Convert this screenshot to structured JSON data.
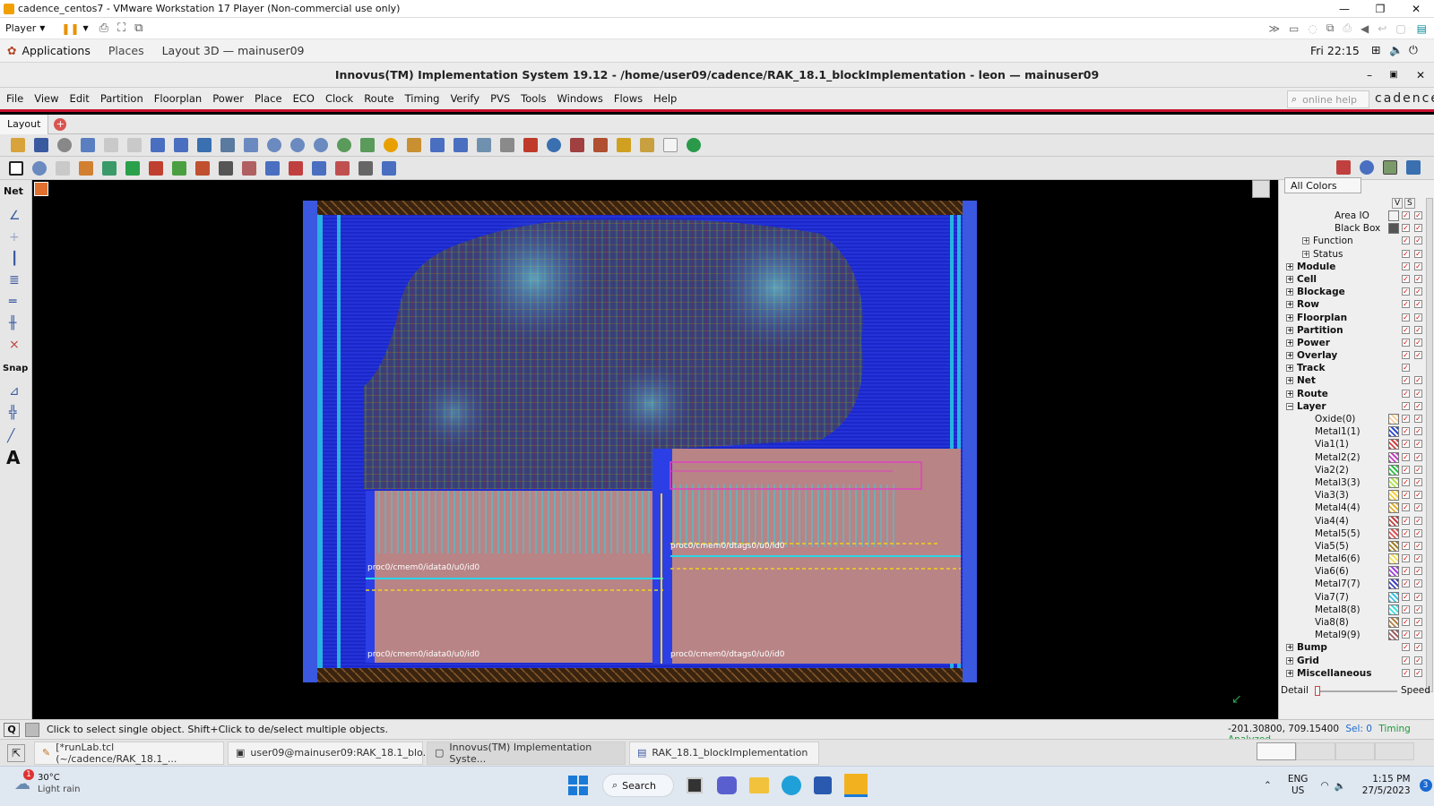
{
  "vm": {
    "title": "cadence_centos7 - VMware Workstation 17 Player (Non-commercial use only)",
    "player_label": "Player"
  },
  "gnome": {
    "applications": "Applications",
    "places": "Places",
    "window": "Layout 3D — mainuser09",
    "clock": "Fri 22:15"
  },
  "app": {
    "title": "Innovus(TM) Implementation System 19.12 - /home/user09/cadence/RAK_18.1_blockImplementation - leon — mainuser09",
    "menu": [
      "File",
      "View",
      "Edit",
      "Partition",
      "Floorplan",
      "Power",
      "Place",
      "ECO",
      "Clock",
      "Route",
      "Timing",
      "Verify",
      "PVS",
      "Tools",
      "Windows",
      "Flows",
      "Help"
    ],
    "search_placeholder": "online help",
    "brand": "cadence",
    "tab": "Layout"
  },
  "left_toolbar": {
    "net_label": "Net",
    "snap_label": "Snap",
    "text_label": "A"
  },
  "canvas": {
    "labels": [
      "proc0/cmem0/idata0/u0/id0",
      "proc0/cmem0/dtags0/u0/id0",
      "proc0/cmem0/idata0/u0/id0",
      "proc0/cmem0/dtags0/u0/id0"
    ]
  },
  "right_panel": {
    "all_colors": "All Colors",
    "col_v": "V",
    "col_s": "S",
    "sub_items": [
      "Area IO",
      "Black Box",
      "Function",
      "Status"
    ],
    "categories": [
      "Module",
      "Cell",
      "Blockage",
      "Row",
      "Floorplan",
      "Partition",
      "Power",
      "Overlay",
      "Track",
      "Net",
      "Route",
      "Layer"
    ],
    "layers": [
      "Oxide(0)",
      "Metal1(1)",
      "Via1(1)",
      "Metal2(2)",
      "Via2(2)",
      "Metal3(3)",
      "Via3(3)",
      "Metal4(4)",
      "Via4(4)",
      "Metal5(5)",
      "Via5(5)",
      "Metal6(6)",
      "Via6(6)",
      "Metal7(7)",
      "Via7(7)",
      "Metal8(8)",
      "Via8(8)",
      "Metal9(9)"
    ],
    "bottom_categories": [
      "Bump",
      "Grid",
      "Miscellaneous"
    ],
    "detail": "Detail",
    "speed": "Speed"
  },
  "status": {
    "message": "Click to select single object. Shift+Click to de/select multiple objects.",
    "coords": "-201.30800, 709.15400",
    "sel": "Sel: 0",
    "timing": "Timing Analyzed",
    "q": "Q"
  },
  "taskbar": {
    "items": [
      "[*runLab.tcl (~/cadence/RAK_18.1_...",
      "user09@mainuser09:RAK_18.1_blo...",
      "Innovus(TM) Implementation Syste...",
      "RAK_18.1_blockImplementation"
    ]
  },
  "windows": {
    "weather_temp": "30°C",
    "weather_desc": "Light rain",
    "search": "Search",
    "lang1": "ENG",
    "lang2": "US",
    "time": "1:15 PM",
    "date": "27/5/2023",
    "notif_count": "1",
    "badge_count": "3"
  },
  "colors": {
    "accent_red": "#c8102e",
    "die_blue": "#1428d8",
    "macro_pink": "#b88486",
    "ring_brown": "#6a3a1e",
    "wire_cyan": "#2ad6e6",
    "selection_yellow": "#f2d21c"
  }
}
